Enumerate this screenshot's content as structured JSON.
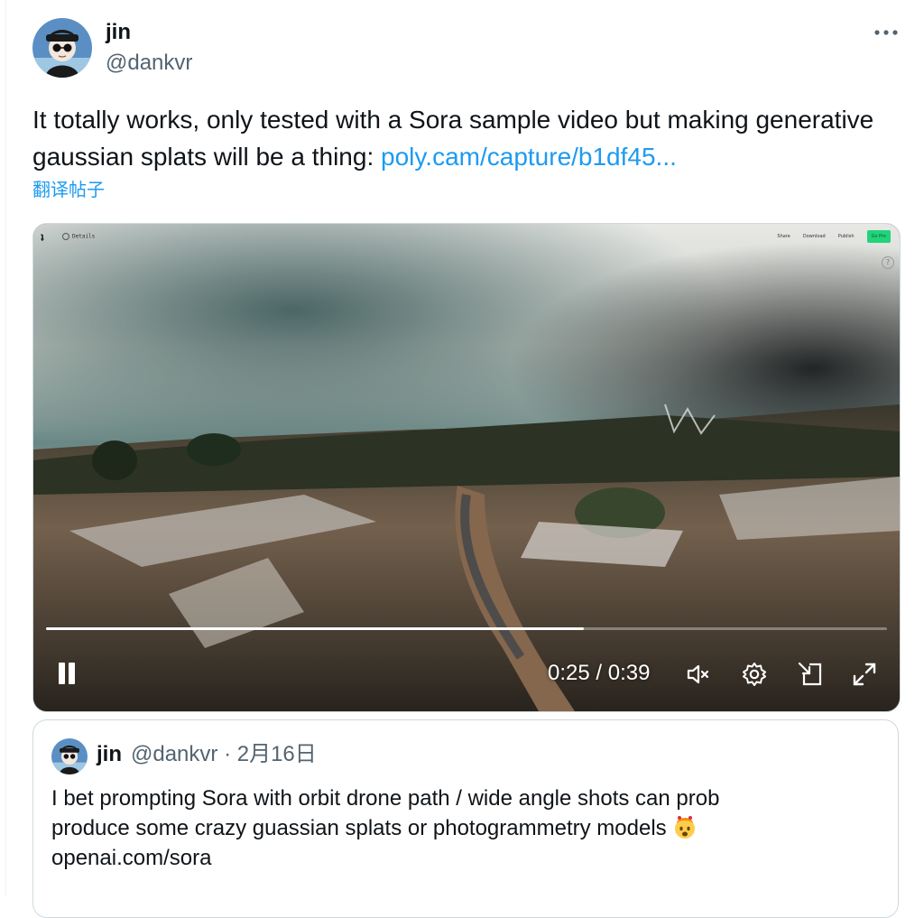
{
  "tweet": {
    "author": {
      "name": "jin",
      "handle": "@dankvr"
    },
    "text": "It totally works, only tested with a Sora sample video but making generative gaussian splats will be a thing: ",
    "link": "poly.cam/capture/b1df45...",
    "translate": "翻译帖子",
    "more_icon": "more-horizontal-icon"
  },
  "video": {
    "app_bar": {
      "logo": "ʇ",
      "details": "Details",
      "actions": [
        "Share",
        "Download",
        "Publish"
      ],
      "pro_label": "Go Pro",
      "help": "?"
    },
    "current_time": "0:25",
    "total_time": "0:39",
    "time_separator": " / ",
    "progress": 0.64,
    "controls": [
      "pause-icon",
      "mute-icon",
      "settings-icon",
      "pip-icon",
      "fullscreen-icon"
    ]
  },
  "quote": {
    "author": {
      "name": "jin",
      "handle": "@dankvr"
    },
    "meta": "@dankvr · 2月16日",
    "text_line1": "I bet prompting Sora with orbit drone path / wide angle shots can prob",
    "text_line2": "produce some crazy guassian splats or photogrammetry models ",
    "text_line3": "openai.com/sora",
    "emoji": "exploding-head-emoji"
  },
  "colors": {
    "link": "#1d9bf0",
    "secondary_text": "#536471",
    "border": "#cfd9de",
    "pro_badge": "#22d37a"
  }
}
